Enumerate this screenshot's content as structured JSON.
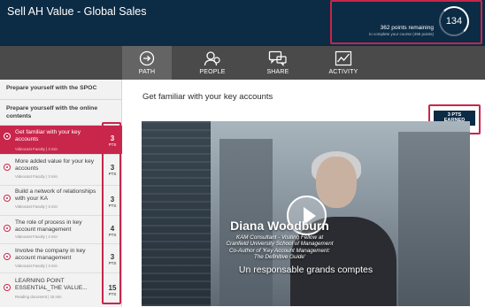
{
  "header": {
    "title": "Sell AH Value - Global Sales",
    "points_remaining": "362 points remaining",
    "points_sub": "to complete your course (496 points)",
    "points_circle": "134"
  },
  "nav": {
    "items": [
      {
        "label": "PATH",
        "icon": "path-icon"
      },
      {
        "label": "PEOPLE",
        "icon": "people-icon"
      },
      {
        "label": "SHARE",
        "icon": "share-icon"
      },
      {
        "label": "ACTIVITY",
        "icon": "activity-icon"
      }
    ]
  },
  "sidebar": {
    "sections": [
      "Prepare yourself with the SPOC",
      "Prepare yourself with the online contents"
    ],
    "lessons": [
      {
        "title": "Get familiar with your key accounts",
        "meta": "Videocast Faculty | 3 min",
        "points": "3",
        "unit": "PTS"
      },
      {
        "title": "More added value for your key accounts",
        "meta": "Videocast Faculty | 3 min",
        "points": "3",
        "unit": "PTS"
      },
      {
        "title": "Build a network of relationships with your KA",
        "meta": "Videocast Faculty | 3 min",
        "points": "3",
        "unit": "PTS"
      },
      {
        "title": "The role of process in key account management",
        "meta": "Videocast Faculty | 4 min",
        "points": "4",
        "unit": "PTS"
      },
      {
        "title": "Involve the company in key account management",
        "meta": "Videocast Faculty | 3 min",
        "points": "3",
        "unit": "PTS"
      },
      {
        "title": "LEARNING POINT ESSENTIAL_THE VALUE...",
        "meta": "Reading document | 15 min",
        "points": "15",
        "unit": "PTS"
      }
    ]
  },
  "main": {
    "title": "Get familiar with your key accounts",
    "earned_line1": "3 PTS",
    "earned_line2": "EARNED",
    "video": {
      "speaker_name": "Diana Woodburn",
      "speaker_role_1": "KAM Consultant - Visiting Fellow at",
      "speaker_role_2": "Cranfield University School of Management",
      "speaker_role_3": "Co-Author of 'Key Account Management:",
      "speaker_role_4": "The Definitive Guide'",
      "subtitle": "Un responsable grands comptes"
    }
  },
  "colors": {
    "header_bg": "#0c2b44",
    "accent": "#c8264b",
    "nav_bg": "#4a4a4a"
  }
}
